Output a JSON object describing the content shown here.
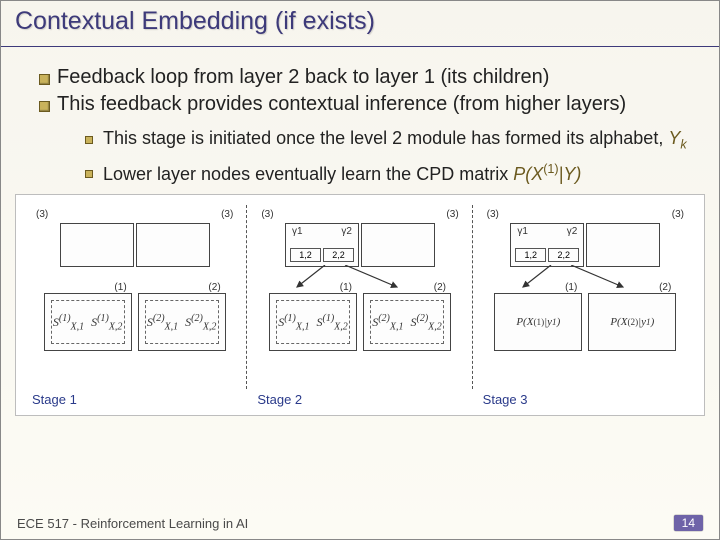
{
  "title": "Contextual Embedding (if exists)",
  "bullets": {
    "b1": "Feedback loop from layer 2 back to layer 1 (its children)",
    "b2": "This feedback provides contextual inference (from higher layers)",
    "sub1_pre": "This stage is initiated once the level 2 module has formed its alphabet, ",
    "sub1_var": "Y",
    "sub1_sub": "k",
    "sub2_pre": "Lower layer nodes eventually learn the CPD matrix ",
    "sub2_expr_P": "P",
    "sub2_expr_open": "(",
    "sub2_expr_X": "X",
    "sub2_expr_sup": "(1)",
    "sub2_expr_bar": "|",
    "sub2_expr_Y": "Y",
    "sub2_expr_close": ")"
  },
  "figure": {
    "level_label_top": "(3)",
    "level_label_low_l": "(1)",
    "level_label_low_r": "(2)",
    "gamma1": "γ1",
    "gamma2": "γ2",
    "cell12": "1,2",
    "cell22": "2,2",
    "s1a": "S",
    "sx1_1": "X,1",
    "sx1_2": "X,2",
    "sup1": "(1)",
    "sup2": "(2)",
    "px1": "P(X(1)|y1)",
    "px2": "P(X(2)|y1)",
    "stage1": "Stage 1",
    "stage2": "Stage 2",
    "stage3": "Stage 3"
  },
  "footer": {
    "course": "ECE 517 - Reinforcement Learning in AI",
    "page": "14"
  }
}
